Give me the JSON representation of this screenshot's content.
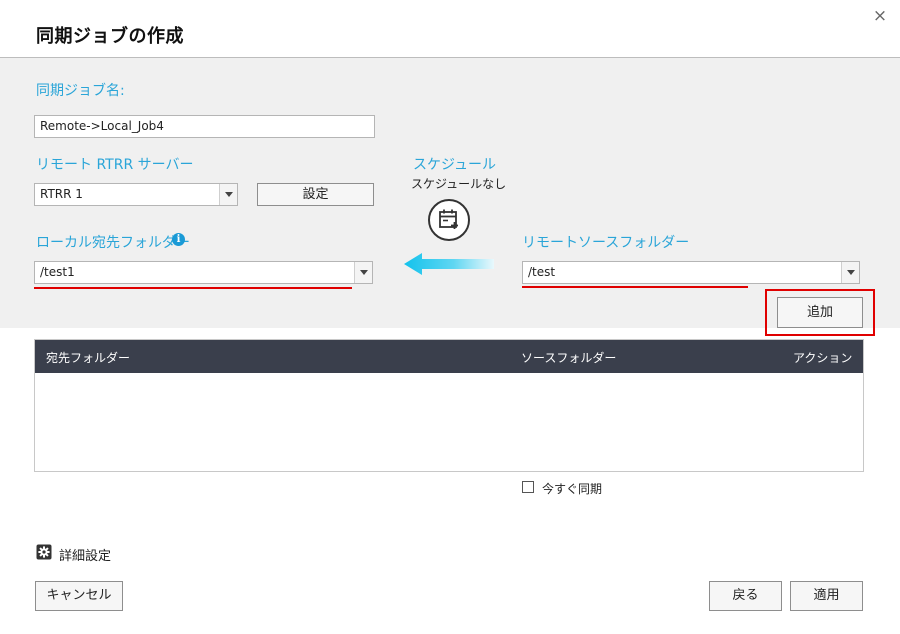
{
  "dialog": {
    "title": "同期ジョブの作成",
    "close_glyph": "×"
  },
  "job_name": {
    "label": "同期ジョブ名:",
    "value": "Remote->Local_Job4"
  },
  "server": {
    "label": "リモート RTRR サーバー",
    "selected": "RTRR 1",
    "settings_button": "設定"
  },
  "schedule": {
    "label": "スケジュール",
    "status": "スケジュールなし",
    "icon": "calendar-add-icon"
  },
  "local_folder": {
    "label": "ローカル宛先フォルダー",
    "info_glyph": "i",
    "selected": "/test1"
  },
  "remote_folder": {
    "label": "リモートソースフォルダー",
    "selected": "/test"
  },
  "add_button": "追加",
  "table": {
    "columns": [
      "宛先フォルダー",
      "ソースフォルダー",
      "アクション"
    ],
    "rows": []
  },
  "sync_now": {
    "label": "今すぐ同期",
    "checked": false
  },
  "advanced": {
    "label": "詳細設定",
    "icon": "gear-icon"
  },
  "footer": {
    "cancel": "キャンセル",
    "back": "戻る",
    "apply": "適用"
  },
  "colors": {
    "accent_blue": "#2aa5d8",
    "highlight_red": "#e00000",
    "table_header": "#3a3f4c",
    "arrow_cyan": "#1ec8ee"
  }
}
